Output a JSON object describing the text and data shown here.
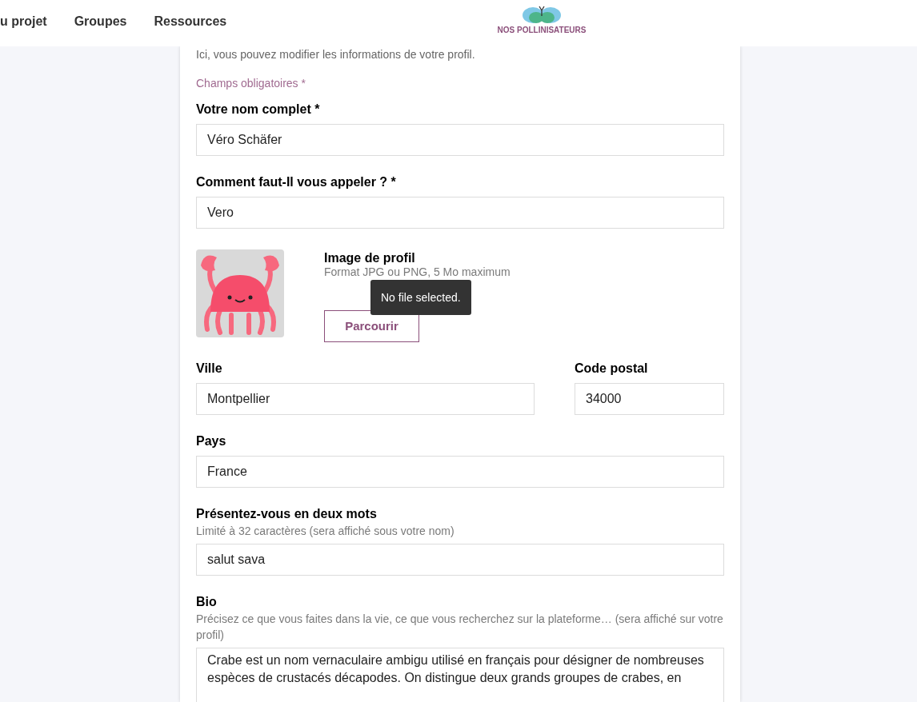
{
  "nav": {
    "items": [
      "u projet",
      "Groupes",
      "Ressources"
    ]
  },
  "logo": {
    "text": "NOS POLLINISATEURS"
  },
  "intro": "Ici, vous pouvez modifier les informations de votre profil.",
  "required_note": "Champs obligatoires *",
  "fields": [
    {
      "label": "Votre nom complet *",
      "value": "Véro Schäfer"
    },
    {
      "label": "Comment faut-Il vous appeler ? *",
      "value": "Vero"
    }
  ],
  "image": {
    "label": "Image de profil",
    "hint": "Format JPG ou PNG, 5 Mo maximum",
    "button": "Parcourir",
    "tooltip": "No file selected."
  },
  "city": {
    "label": "Ville",
    "value": "Montpellier"
  },
  "postcode": {
    "label": "Code postal",
    "value": "34000"
  },
  "country": {
    "label": "Pays",
    "value": "France"
  },
  "tagline": {
    "label": "Présentez-vous en deux mots",
    "hint": "Limité à 32 caractères (sera affiché sous votre nom)",
    "value": "salut sava"
  },
  "bio": {
    "label": "Bio",
    "hint": "Précisez ce que vous faites dans la vie, ce que vous recherchez sur la plateforme… (sera affiché sur votre profil)",
    "value": "Crabe est un nom vernaculaire ambigu utilisé en français pour désigner de nombreuses espèces de crustacés décapodes. On distingue deux grands groupes de crabes, en"
  }
}
